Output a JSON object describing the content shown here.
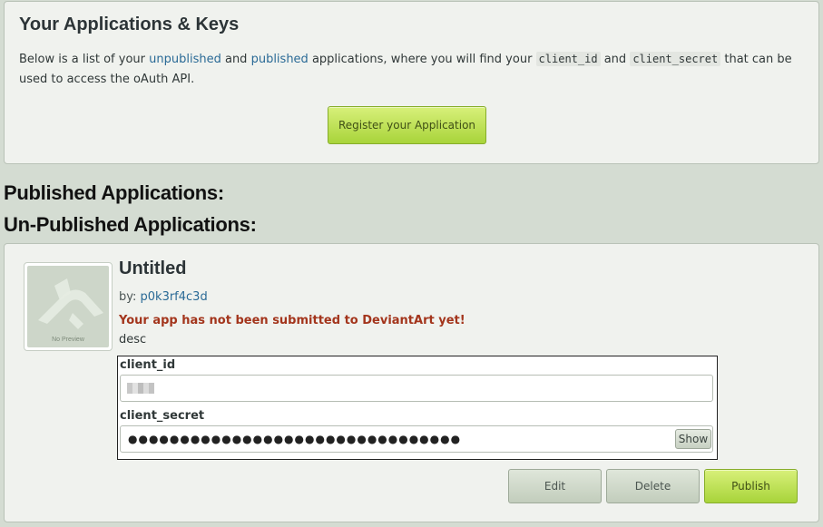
{
  "intro": {
    "title": "Your Applications & Keys",
    "text_1": "Below is a list of your ",
    "link_unpublished": "unpublished",
    "text_2": " and ",
    "link_published": "published",
    "text_3": " applications, where you will find your ",
    "code_client_id": "client_id",
    "text_4": " and ",
    "code_client_secret": "client_secret",
    "text_5": " that can be used to access the oAuth API.",
    "register_button": "Register your Application"
  },
  "sections": {
    "published": "Published Applications:",
    "unpublished": "Un-Published Applications:"
  },
  "app": {
    "thumbnail_caption": "No Preview",
    "title": "Untitled",
    "by_label": "by: ",
    "author": "p0k3rf4c3d",
    "warning": "Your app has not been submitted to DeviantArt yet!",
    "description": "desc",
    "client_id_label": "client_id",
    "client_id_value": "",
    "client_secret_label": "client_secret",
    "client_secret_masked": "●●●●●●●●●●●●●●●●●●●●●●●●●●●●●●●●",
    "show_button": "Show",
    "buttons": {
      "edit": "Edit",
      "delete": "Delete",
      "publish": "Publish"
    }
  },
  "colors": {
    "page_bg": "#d4dcd2",
    "panel_bg": "#f0f2ee",
    "link": "#2a6a96",
    "warning": "#a3351c",
    "primary_button": "#b9df4f"
  }
}
